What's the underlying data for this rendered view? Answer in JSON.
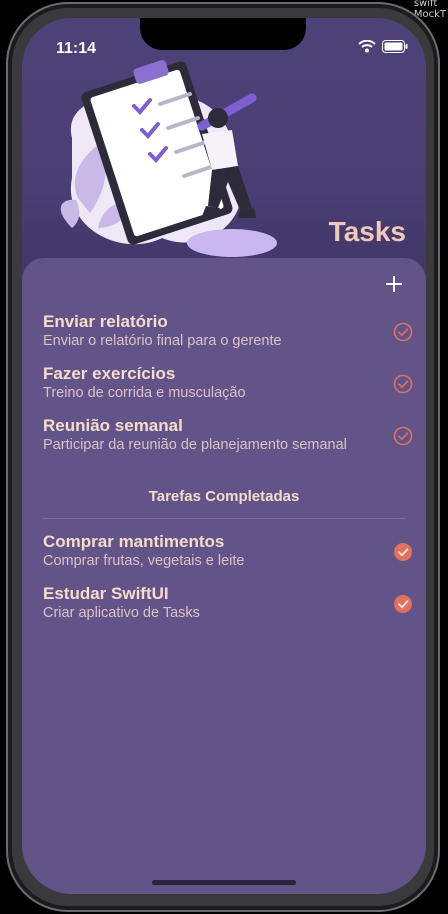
{
  "corner": {
    "line1": "swift",
    "line2": "MockT"
  },
  "status": {
    "time": "11:14"
  },
  "header": {
    "title": "Tasks"
  },
  "icons": {
    "add": "plus-icon",
    "open": "circle-check-outline-icon",
    "done": "circle-check-filled-icon"
  },
  "colors": {
    "accent": "#e2705f",
    "background": "#625388",
    "title": "#f3c9b8"
  },
  "tasks": [
    {
      "title": "Enviar relatório",
      "subtitle": "Enviar o relatório final para o gerente"
    },
    {
      "title": "Fazer exercícios",
      "subtitle": "Treino de corrida e musculação"
    },
    {
      "title": "Reunião semanal",
      "subtitle": "Participar da reunião de planejamento semanal"
    }
  ],
  "completed_section": {
    "title": "Tarefas Completadas"
  },
  "completed": [
    {
      "title": "Comprar mantimentos",
      "subtitle": "Comprar frutas, vegetais e leite"
    },
    {
      "title": "Estudar SwiftUI",
      "subtitle": "Criar aplicativo de Tasks"
    }
  ]
}
